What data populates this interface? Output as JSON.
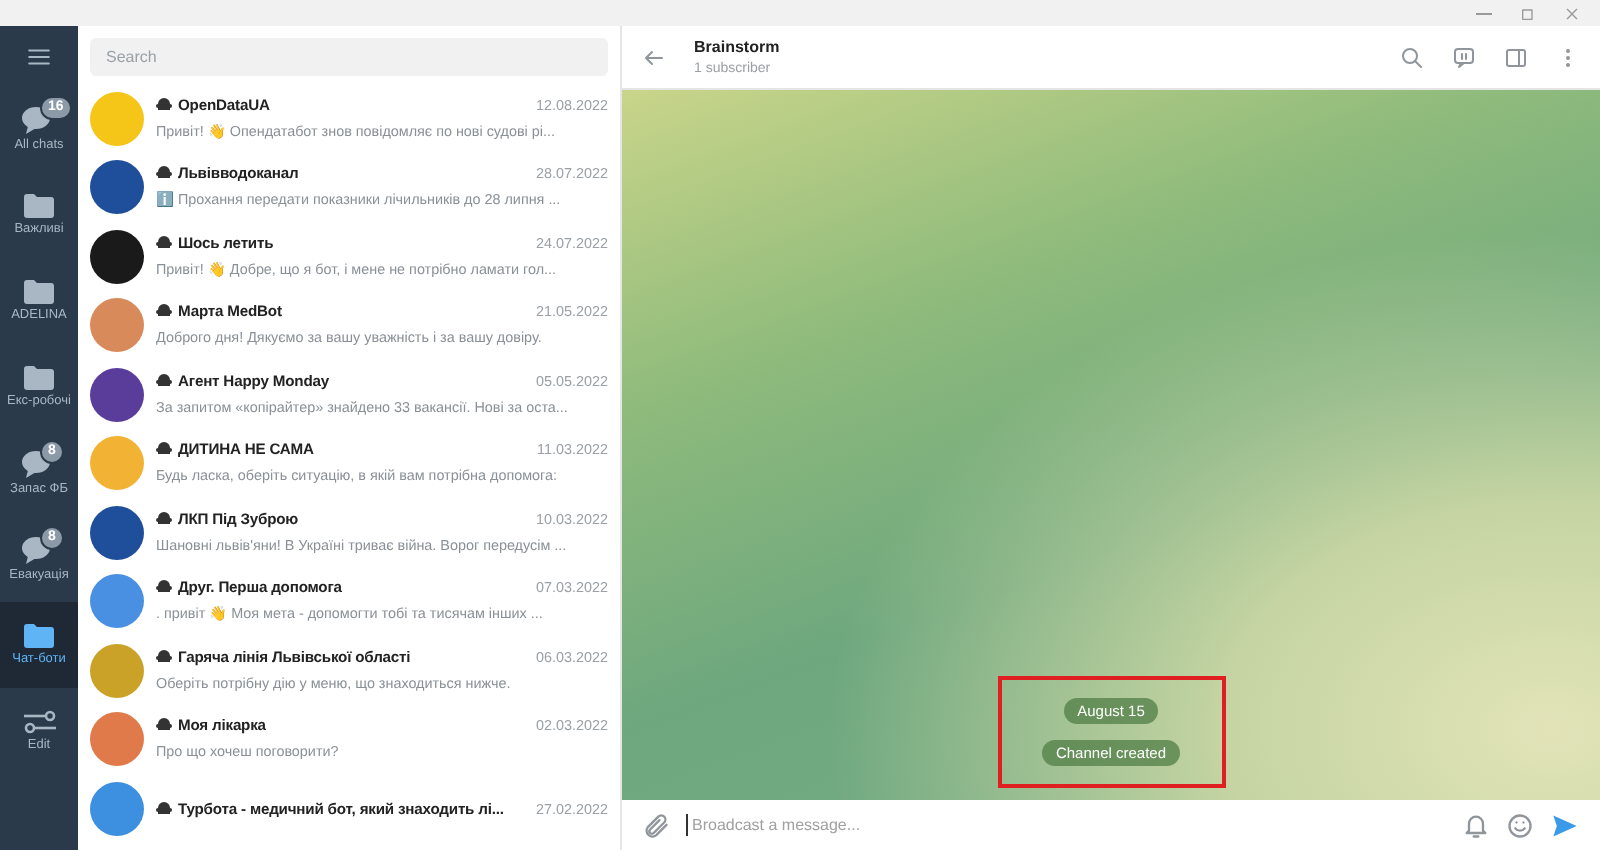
{
  "folders": [
    {
      "kind": "menu"
    },
    {
      "kind": "chats",
      "label": "All chats",
      "badge": "16",
      "selected": false
    },
    {
      "kind": "folder",
      "label": "Важливі",
      "selected": false
    },
    {
      "kind": "folder",
      "label": "ADELINA",
      "selected": false
    },
    {
      "kind": "folder",
      "label": "Екс-робочі",
      "selected": false
    },
    {
      "kind": "chats",
      "label": "Запас ФБ",
      "badge": "8",
      "selected": false
    },
    {
      "kind": "chats",
      "label": "Евакуація",
      "badge": "8",
      "selected": false
    },
    {
      "kind": "folder",
      "label": "Чат-боти",
      "selected": true
    },
    {
      "kind": "edit",
      "label": "Edit",
      "selected": false
    }
  ],
  "search": {
    "placeholder": "Search"
  },
  "chats": [
    {
      "name": "OpenDataUA",
      "date": "12.08.2022",
      "preview": "Привіт! 👋 Опендатабот знов повідомляє по нові судові рі...",
      "color": "#f5c518"
    },
    {
      "name": "Львівводоканал",
      "date": "28.07.2022",
      "preview": "ℹ️ Прохання передати показники лічильників до 28 липня ...",
      "color": "#1f4e9a"
    },
    {
      "name": "Шось летить",
      "date": "24.07.2022",
      "preview": "Привіт! 👋 Добре, що я бот, і мене не потрібно ламати гол...",
      "color": "#1a1a1a"
    },
    {
      "name": "Марта MedBot",
      "date": "21.05.2022",
      "preview": "Доброго дня! Дякуємо за вашу уважність і за вашу довіру.",
      "color": "#d88a5a"
    },
    {
      "name": "Агент Happy Monday",
      "date": "05.05.2022",
      "preview": "За запитом «копірайтер» знайдено 33 вакансії.  Нові за оста...",
      "color": "#5a3d9a"
    },
    {
      "name": "ДИТИНА НЕ САМА",
      "date": "11.03.2022",
      "preview": "Будь ласка, оберіть ситуацію, в якій вам потрібна допомога:",
      "color": "#f2b233"
    },
    {
      "name": "ЛКП Під Зуброю",
      "date": "10.03.2022",
      "preview": "Шановні львів'яни!  В Україні триває війна. Ворог передусім ...",
      "color": "#1f4e9a"
    },
    {
      "name": "Друг. Перша допомога",
      "date": "07.03.2022",
      "preview": ". привіт 👋  Моя мета - допомогти тобі та тисячам інших ...",
      "color": "#4a90e2"
    },
    {
      "name": "Гаряча лінія Львівської області",
      "date": "06.03.2022",
      "preview": "Оберіть потрібну дію у меню, що знаходиться нижче.",
      "color": "#c9a227"
    },
    {
      "name": "Моя лікарка",
      "date": "02.03.2022",
      "preview": "Про що хочеш поговорити?",
      "color": "#e07a4a"
    },
    {
      "name": "Турбота - медичний бот, який знаходить лі...",
      "date": "27.02.2022",
      "color": "#3d8fe0"
    }
  ],
  "header": {
    "title": "Brainstorm",
    "subtitle": "1 subscriber"
  },
  "service_messages": [
    "August 15",
    "Channel created"
  ],
  "composer": {
    "placeholder": "Broadcast a message..."
  }
}
